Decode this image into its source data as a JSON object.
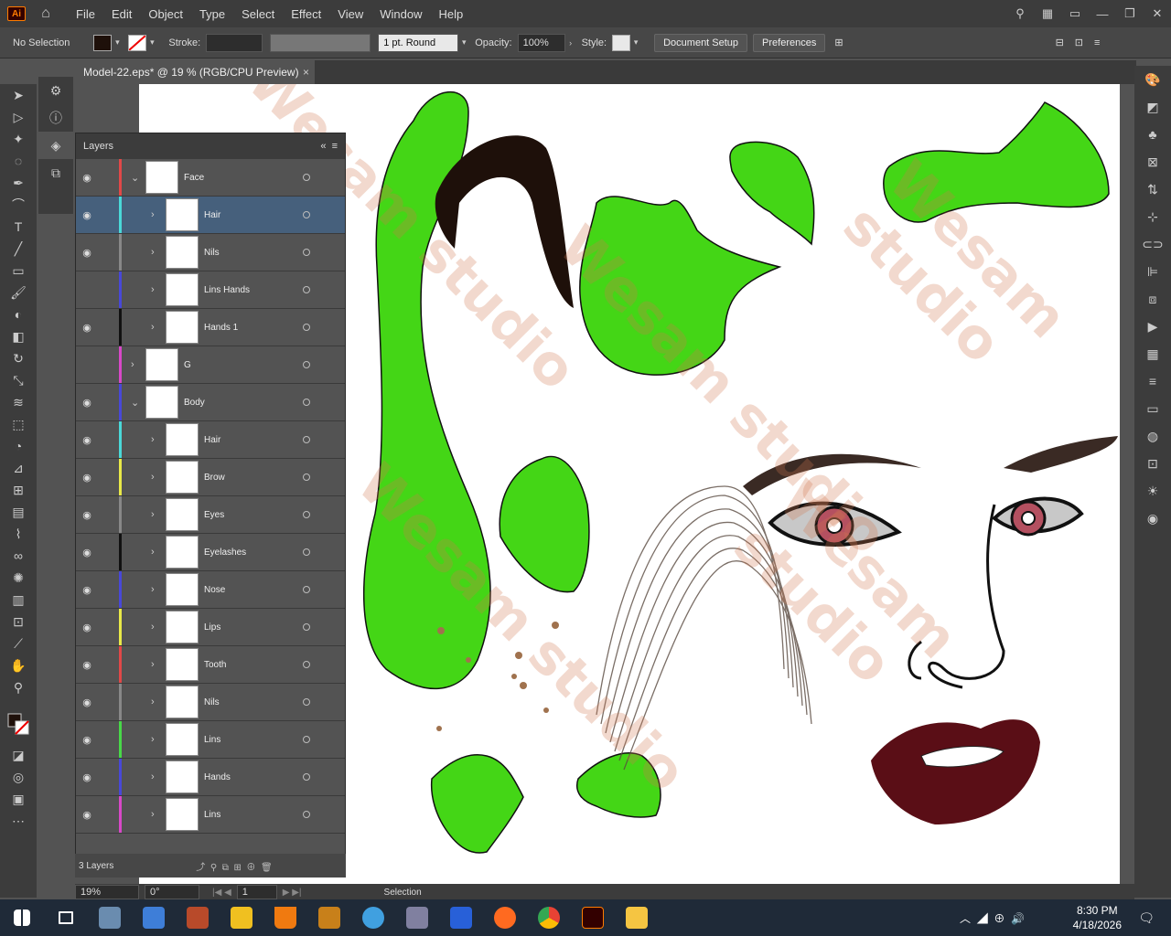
{
  "menubar": {
    "logo": "Ai",
    "items": [
      "File",
      "Edit",
      "Object",
      "Type",
      "Select",
      "Effect",
      "View",
      "Window",
      "Help"
    ]
  },
  "control": {
    "selection": "No Selection",
    "stroke_label": "Stroke:",
    "stroke_style": "1 pt. Round",
    "opacity_label": "Opacity:",
    "opacity": "100%",
    "style_label": "Style:",
    "doc_setup": "Document Setup",
    "preferences": "Preferences"
  },
  "doc": {
    "tab_title": "Model-22.eps* @ 19 % (RGB/CPU Preview)",
    "close": "×"
  },
  "layers": {
    "title": "Layers",
    "count": "3 Layers",
    "rows": [
      {
        "name": "Face",
        "color": "#e04848",
        "eye": true,
        "indent": 0,
        "expanded": true,
        "selected": false
      },
      {
        "name": "Hair",
        "color": "#4ad8d8",
        "eye": true,
        "indent": 1,
        "expanded": false,
        "selected": true
      },
      {
        "name": "Nils",
        "color": "#888888",
        "eye": true,
        "indent": 1,
        "expanded": false,
        "selected": false
      },
      {
        "name": "Lins Hands",
        "color": "#4848d8",
        "eye": false,
        "indent": 1,
        "expanded": false,
        "selected": false
      },
      {
        "name": "Hands 1",
        "color": "#111111",
        "eye": true,
        "indent": 1,
        "expanded": false,
        "selected": false
      },
      {
        "name": "G",
        "color": "#d848c8",
        "eye": false,
        "indent": 0,
        "expanded": false,
        "selected": false
      },
      {
        "name": "Body",
        "color": "#4848d8",
        "eye": true,
        "indent": 0,
        "expanded": true,
        "selected": false
      },
      {
        "name": "Hair",
        "color": "#4ad8d8",
        "eye": true,
        "indent": 1,
        "expanded": false,
        "selected": false
      },
      {
        "name": "Brow",
        "color": "#e8e848",
        "eye": true,
        "indent": 1,
        "expanded": false,
        "selected": false
      },
      {
        "name": "Eyes",
        "color": "#888888",
        "eye": true,
        "indent": 1,
        "expanded": false,
        "selected": false
      },
      {
        "name": "Eyelashes",
        "color": "#111111",
        "eye": true,
        "indent": 1,
        "expanded": false,
        "selected": false
      },
      {
        "name": "Nose",
        "color": "#4848d8",
        "eye": true,
        "indent": 1,
        "expanded": false,
        "selected": false
      },
      {
        "name": "Lips",
        "color": "#e8e848",
        "eye": true,
        "indent": 1,
        "expanded": false,
        "selected": false
      },
      {
        "name": "Tooth",
        "color": "#e04848",
        "eye": true,
        "indent": 1,
        "expanded": false,
        "selected": false
      },
      {
        "name": "Nils",
        "color": "#888888",
        "eye": true,
        "indent": 1,
        "expanded": false,
        "selected": false
      },
      {
        "name": "Lins",
        "color": "#48d848",
        "eye": true,
        "indent": 1,
        "expanded": false,
        "selected": false
      },
      {
        "name": "Hands",
        "color": "#4848d8",
        "eye": true,
        "indent": 1,
        "expanded": false,
        "selected": false
      },
      {
        "name": "Lins",
        "color": "#d848c8",
        "eye": true,
        "indent": 1,
        "expanded": false,
        "selected": false
      }
    ]
  },
  "status": {
    "zoom": "19%",
    "rotation": "0°",
    "artboard": "1",
    "tool": "Selection"
  },
  "taskbar": {
    "time": "8:30 PM",
    "date": "4/18/2026"
  },
  "watermark": "Wesam studio",
  "colors": {
    "green": "#44d616",
    "hair": "#1e100a",
    "lips": "#5a0e16"
  }
}
